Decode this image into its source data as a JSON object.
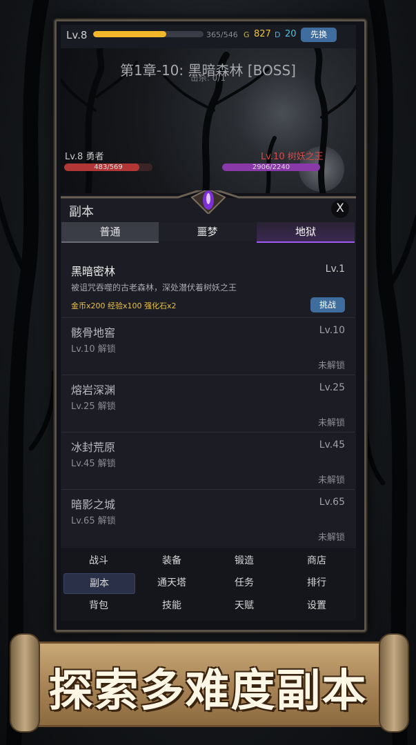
{
  "topbar": {
    "level": "Lv.8",
    "xp_fraction": 0.665,
    "xp_text": "365/546",
    "gold_symbol": "G",
    "gold": "827",
    "diamond_symbol": "D",
    "diamond": "20",
    "button": "先换"
  },
  "battle": {
    "stage_title": "第1章-10: 黑暗森林 [BOSS]",
    "stage_sub": "击杀: 0/1",
    "hero_name": "Lv.8 勇者",
    "hero_hp_text": "483/569",
    "hero_hp_fraction": 0.849,
    "boss_name": "Lv.10 树妖之王",
    "boss_hp_text": "2906/2240",
    "boss_hp_fraction": 1.0
  },
  "panel": {
    "title": "副本",
    "close": "X",
    "tabs": [
      "普通",
      "噩梦",
      "地狱"
    ]
  },
  "dungeons": [
    {
      "name": "黑暗密林",
      "lv": "Lv.1",
      "desc": "被诅咒吞噬的古老森林，深处潜伏着树妖之王",
      "rewards": "金币x200  经验x100  强化石x2",
      "button": "挑战"
    },
    {
      "name": "骸骨地窖",
      "lv": "Lv.10",
      "unlock": "Lv.10 解锁",
      "status": "未解锁"
    },
    {
      "name": "熔岩深渊",
      "lv": "Lv.25",
      "unlock": "Lv.25 解锁",
      "status": "未解锁"
    },
    {
      "name": "冰封荒原",
      "lv": "Lv.45",
      "unlock": "Lv.45 解锁",
      "status": "未解锁"
    },
    {
      "name": "暗影之城",
      "lv": "Lv.65",
      "unlock": "Lv.65 解锁",
      "status": "未解锁"
    }
  ],
  "nav": [
    [
      "战斗",
      "装备",
      "锻造",
      "商店"
    ],
    [
      "副本",
      "通天塔",
      "任务",
      "排行"
    ],
    [
      "背包",
      "技能",
      "天赋",
      "设置"
    ]
  ],
  "banner": {
    "text": "探索多难度副本"
  },
  "colors": {
    "accent_purple": "#a35bff",
    "gold": "#f0c43a",
    "hp_red": "#b33636",
    "boss_purple": "#8a3aa8"
  }
}
